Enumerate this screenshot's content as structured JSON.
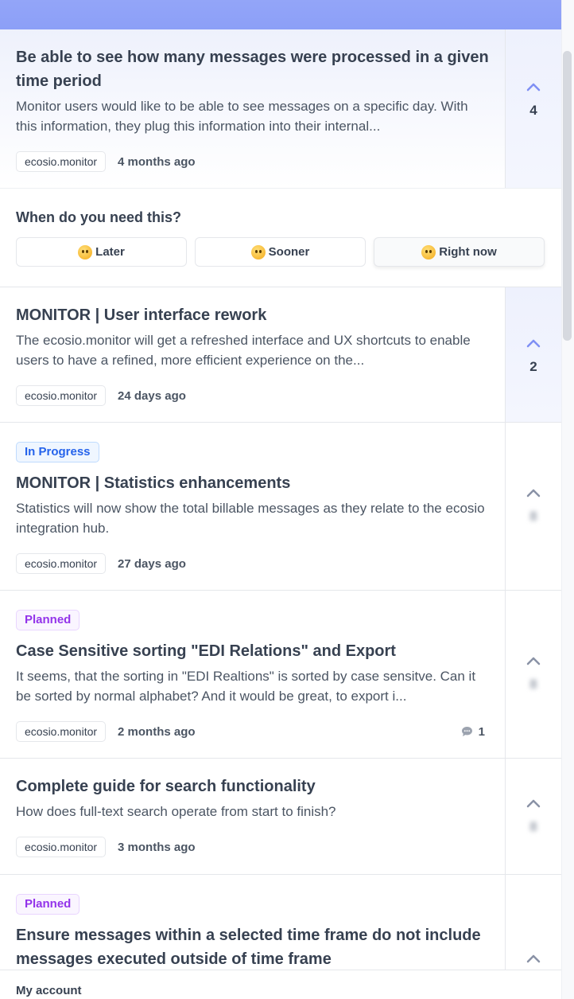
{
  "colors": {
    "accent": "#8c9ff7",
    "chevron": "#7f8ff4",
    "chevron_muted": "#8a92a6"
  },
  "posts_top": [
    {
      "title": "Be able to see how many messages were processed in a given time period",
      "description": "Monitor users would like to be able to see messages on a specific day. With this information, they plug this information into their internal...",
      "tag": "ecosio.monitor",
      "time": "4 months ago",
      "votes": "4"
    }
  ],
  "need": {
    "title": "When do you need this?",
    "options": [
      {
        "label": "Later",
        "icon": "sleepy-face-icon"
      },
      {
        "label": "Sooner",
        "icon": "smiley-face-icon"
      },
      {
        "label": "Right now",
        "icon": "star-struck-face-icon"
      }
    ]
  },
  "posts": [
    {
      "status": "",
      "title": "MONITOR | User interface rework",
      "description": "The ecosio.monitor will get a refreshed interface and UX shortcuts to enable users to have a refined, more efficient experience on the...",
      "tag": "ecosio.monitor",
      "time": "24 days ago",
      "votes": "2",
      "comments": ""
    },
    {
      "status": "In Progress",
      "title": "MONITOR | Statistics enhancements",
      "description": "Statistics will now show the total billable messages as they relate to the ecosio integration hub.",
      "tag": "ecosio.monitor",
      "time": "27 days ago",
      "votes": "8",
      "comments": ""
    },
    {
      "status": "Planned",
      "title": "Case Sensitive sorting \"EDI Relations\" and Export",
      "description": "It seems, that the sorting in \"EDI Realtions\" is sorted by case sensitve. Can it be sorted by normal alphabet? And it would be great, to export i...",
      "tag": "ecosio.monitor",
      "time": "2 months ago",
      "votes": "8",
      "comments": "1"
    },
    {
      "status": "",
      "title": "Complete guide for search functionality",
      "description": "How does full-text search operate from start to finish?",
      "tag": "ecosio.monitor",
      "time": "3 months ago",
      "votes": "8",
      "comments": ""
    },
    {
      "status": "Planned",
      "title": "Ensure messages within a selected time frame do not include messages executed outside of time frame",
      "description": "",
      "tag": "",
      "time": "",
      "votes": "",
      "comments": ""
    }
  ],
  "footer": {
    "link": "My account"
  }
}
